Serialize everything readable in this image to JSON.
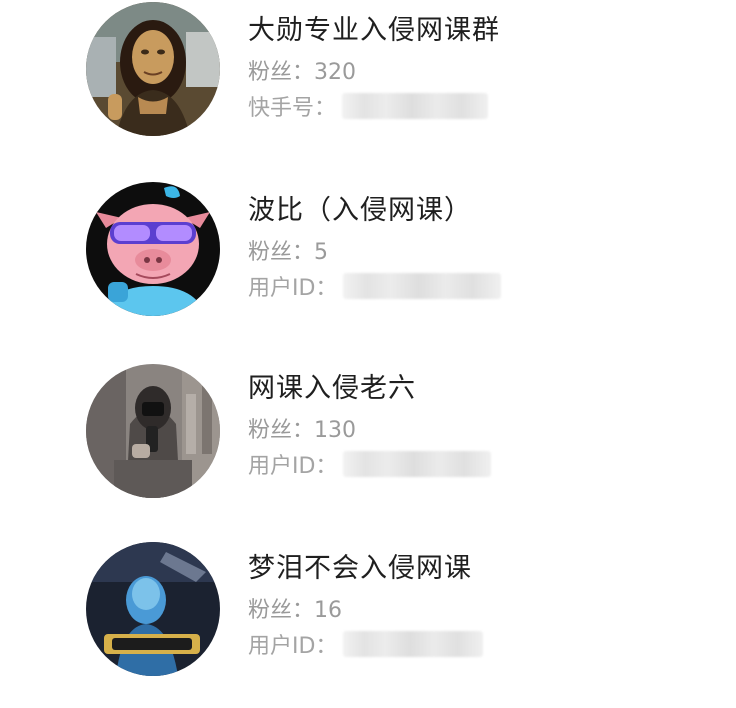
{
  "users": [
    {
      "name": "大勋专业入侵网课群",
      "fans_label": "粉丝：",
      "fans": "320",
      "id_label": "快手号：",
      "colors": {
        "bg": "#3b2a1e",
        "accent": "#8a6a44"
      }
    },
    {
      "name": "波比（入侵网课）",
      "fans_label": "粉丝：",
      "fans": "5",
      "id_label": "用户ID：",
      "colors": {
        "bg": "#0d0d0d",
        "accent": "#f3a6b4"
      }
    },
    {
      "name": "网课入侵老六",
      "fans_label": "粉丝：",
      "fans": "130",
      "id_label": "用户ID：",
      "colors": {
        "bg": "#6f6a66",
        "accent": "#d8d2cc"
      }
    },
    {
      "name": "梦泪不会入侵网课",
      "fans_label": "粉丝：",
      "fans": "16",
      "id_label": "用户ID：",
      "colors": {
        "bg": "#1b2230",
        "accent": "#4a9ad6"
      }
    }
  ]
}
